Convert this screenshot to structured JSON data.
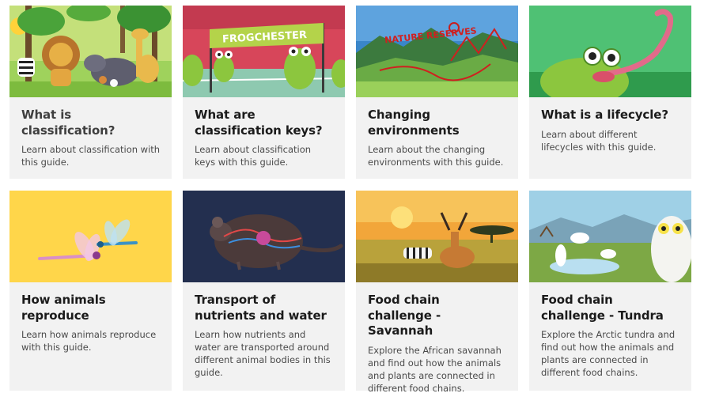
{
  "cards": [
    {
      "title": "What is classification?",
      "description": "Learn about classification with this guide.",
      "image_text": ""
    },
    {
      "title": "What are classification keys?",
      "description": "Learn about classification keys with this guide.",
      "image_text": "FROGCHESTER"
    },
    {
      "title": "Changing environments",
      "description": "Learn about the changing environments with this guide.",
      "image_text": "NATURE RESERVES"
    },
    {
      "title": "What is a lifecycle?",
      "description": "Learn about different lifecycles with this guide.",
      "image_text": ""
    },
    {
      "title": "How animals reproduce",
      "description": "Learn how animals reproduce with this guide.",
      "image_text": ""
    },
    {
      "title": "Transport of nutrients and water",
      "description": "Learn how nutrients and water are transported around different animal bodies in this guide.",
      "image_text": ""
    },
    {
      "title": "Food chain challenge - Savannah",
      "description": "Explore the African savannah and find out how the animals and plants are connected in different food chains.",
      "image_text": ""
    },
    {
      "title": "Food chain challenge - Tundra",
      "description": "Explore the Arctic tundra and find out how the animals and plants are connected in different food chains.",
      "image_text": ""
    }
  ]
}
